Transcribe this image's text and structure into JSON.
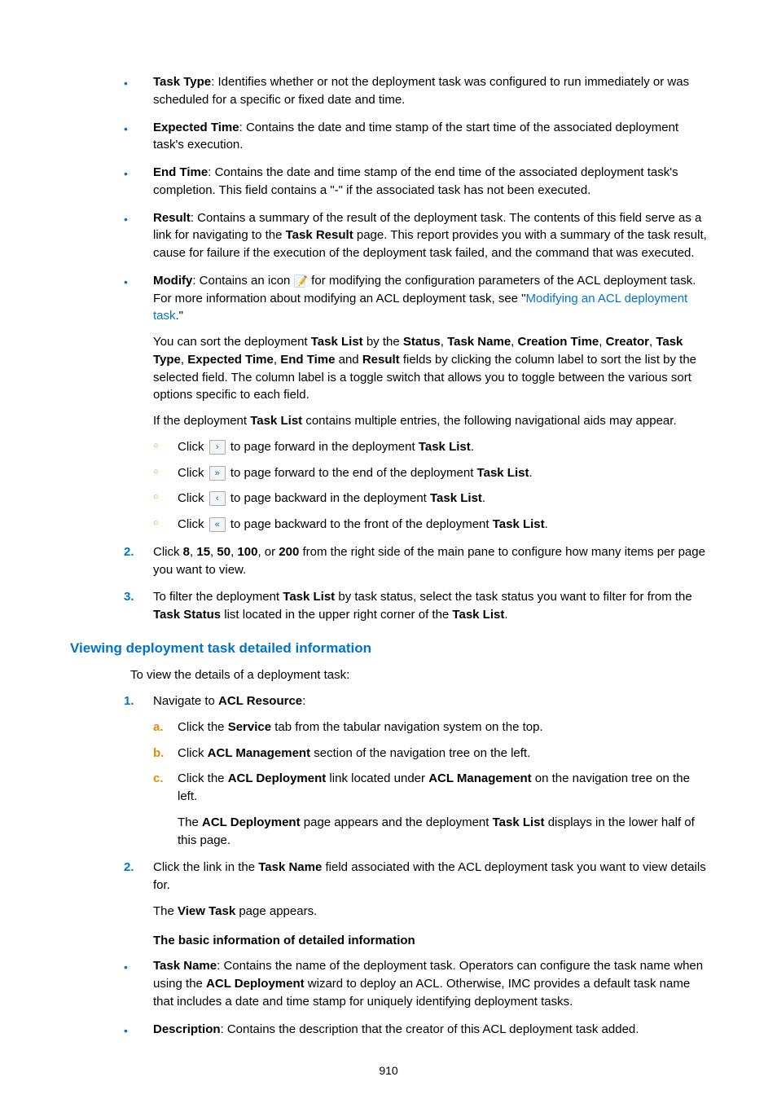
{
  "fields": {
    "taskType": {
      "label": "Task Type",
      "text": ": Identifies whether or not the deployment task was configured to run immediately or was scheduled for a specific or fixed date and time."
    },
    "expectedTime": {
      "label": "Expected Time",
      "text": ": Contains the date and time stamp of the start time of the associated deployment task's execution."
    },
    "endTime": {
      "label": "End Time",
      "text": ": Contains the date and time stamp of the end time of the associated deployment task's completion. This field contains a \"-\" if the associated task has not been executed."
    },
    "result": {
      "label": "Result",
      "pre": ": Contains a summary of the result of the deployment task. The contents of this field serve as a link for navigating to the ",
      "bold1": "Task Result",
      "post": " page. This report provides you with a summary of the task result, cause for failure if the execution of the deployment task failed, and the command that was executed."
    },
    "modify": {
      "label": "Modify",
      "pre": ": Contains an icon ",
      "mid": " for modifying the configuration parameters of the ACL deployment task. For more information about modifying an ACL deployment task, see \"",
      "link": "Modifying an ACL deployment task",
      "post": ".\""
    }
  },
  "sortPara": {
    "t1": "You can sort the deployment ",
    "b1": "Task List",
    "t2": " by the ",
    "b2": "Status",
    "t3": ", ",
    "b3": "Task Name",
    "t4": ", ",
    "b4": "Creation Time",
    "t5": ", ",
    "b5": "Creator",
    "t6": ", ",
    "b6": "Task Type",
    "t7": ", ",
    "b7": "Expected Time",
    "t8": ", ",
    "b8": "End Time",
    "t9": " and ",
    "b9": "Result",
    "t10": " fields by clicking the column label to sort the list by the selected field. The column label is a toggle switch that allows you to toggle between the various sort options specific to each field."
  },
  "navIntro": {
    "t1": "If the deployment ",
    "b1": "Task List",
    "t2": " contains multiple entries, the following navigational aids may appear."
  },
  "nav": {
    "click": "Click ",
    "fwd": {
      "t1": " to page forward in the deployment ",
      "b1": "Task List",
      "t2": "."
    },
    "fwdEnd": {
      "t1": " to page forward to the end of the deployment ",
      "b1": "Task List",
      "t2": "."
    },
    "back": {
      "t1": " to page backward in the deployment ",
      "b1": "Task List",
      "t2": "."
    },
    "backFront": {
      "t1": " to page backward to the front of the deployment ",
      "b1": "Task List",
      "t2": "."
    },
    "icons": {
      "next": "›",
      "last": "»",
      "prev": "‹",
      "first": "«"
    }
  },
  "steps": {
    "s2": {
      "num": "2.",
      "t1": "Click ",
      "b1": "8",
      "c1": ", ",
      "b2": "15",
      "c2": ", ",
      "b3": "50",
      "c3": ", ",
      "b4": "100",
      "c4": ", or ",
      "b5": "200",
      "t2": " from the right side of the main pane to configure how many items per page you want to view."
    },
    "s3": {
      "num": "3.",
      "t1": "To filter the deployment ",
      "b1": "Task List",
      "t2": " by task status, select the task status you want to filter for from the ",
      "b2": "Task Status",
      "t3": " list located in the upper right corner of the ",
      "b3": "Task List",
      "t4": "."
    }
  },
  "section2": {
    "heading": "Viewing deployment task detailed information",
    "intro": "To view the details of a deployment task:",
    "step1": {
      "num": "1.",
      "t1": "Navigate to ",
      "b1": "ACL Resource",
      "t2": ":"
    },
    "a": {
      "m": "a.",
      "t1": "Click the ",
      "b1": "Service",
      "t2": " tab from the tabular navigation system on the top."
    },
    "b": {
      "m": "b.",
      "t1": "Click ",
      "b1": "ACL Management",
      "t2": " section of the navigation tree on the left."
    },
    "c": {
      "m": "c.",
      "t1": "Click the ",
      "b1": "ACL Deployment",
      "t2": " link located under ",
      "b2": "ACL Management",
      "t3": " on the navigation tree on the left."
    },
    "cResult": {
      "t1": "The ",
      "b1": "ACL Deployment",
      "t2": " page appears and the deployment ",
      "b2": "Task List",
      "t3": " displays in the lower half of this page."
    },
    "step2": {
      "num": "2.",
      "t1": "Click the link in the ",
      "b1": "Task Name",
      "t2": " field associated with the ACL deployment task you want to view details for."
    },
    "step2Result": {
      "t1": "The ",
      "b1": "View Task",
      "t2": " page appears."
    },
    "subhead": "The basic information of detailed information",
    "taskName": {
      "label": "Task Name",
      "t1": ": Contains the name of the deployment task. Operators can configure the task name when using the ",
      "b1": "ACL Deployment",
      "t2": " wizard to deploy an ACL. Otherwise, IMC provides a default task name that includes a date and time stamp for uniquely identifying deployment tasks."
    },
    "description": {
      "label": "Description",
      "t1": ": Contains the description that the creator of this ACL deployment task added."
    }
  },
  "pageNumber": "910"
}
